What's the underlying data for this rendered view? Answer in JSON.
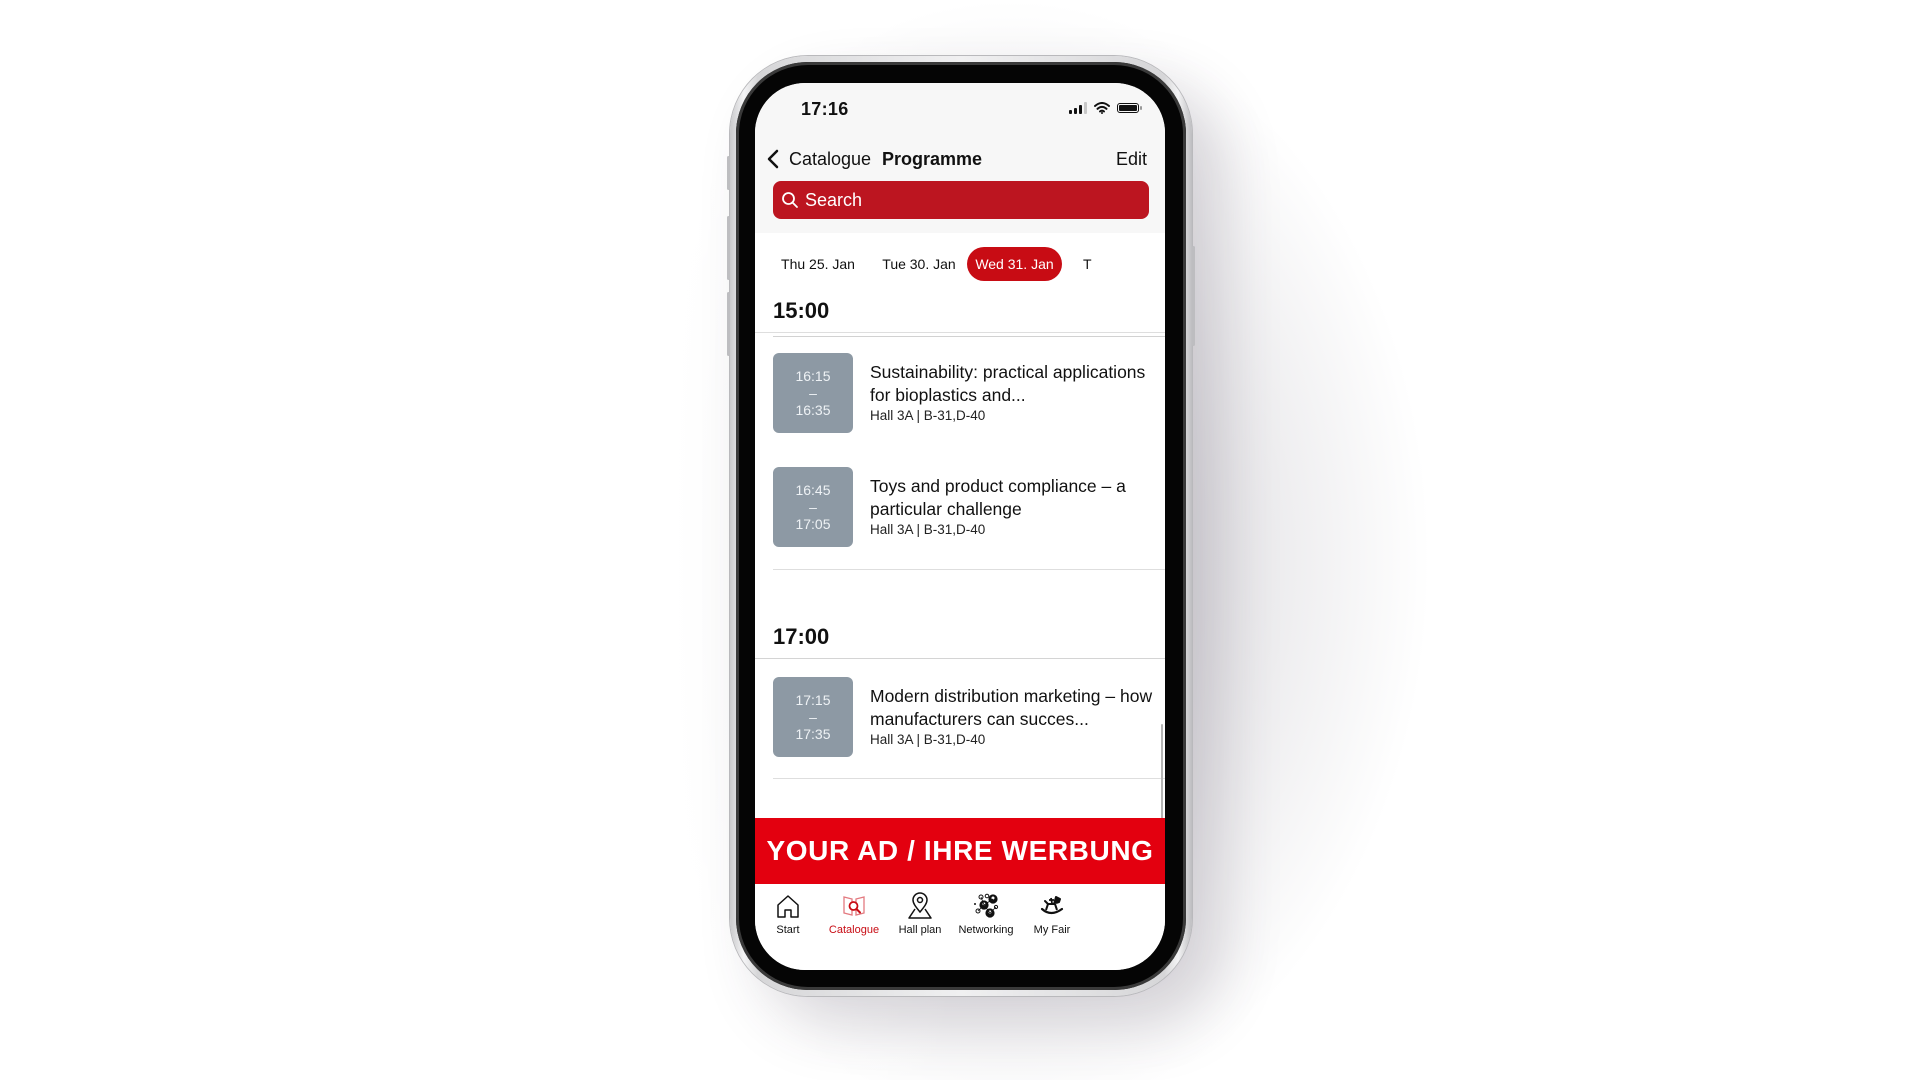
{
  "status_bar": {
    "time": "17:16"
  },
  "nav": {
    "back_label": "Catalogue",
    "title": "Programme",
    "edit_label": "Edit"
  },
  "search": {
    "placeholder": "Search",
    "value": ""
  },
  "date_tabs": [
    {
      "label": "Thu 25. Jan",
      "active": false
    },
    {
      "label": "Tue 30. Jan",
      "active": false
    },
    {
      "label": "Wed 31. Jan",
      "active": true
    },
    {
      "label": "T",
      "active": false
    }
  ],
  "sections": [
    {
      "heading": "15:00",
      "events": [
        {
          "start": "16:15",
          "dash": "–",
          "end": "16:35",
          "title": "Sustainability: practical applications for bioplastics and...",
          "location": "Hall 3A | B-31,D-40"
        },
        {
          "start": "16:45",
          "dash": "–",
          "end": "17:05",
          "title": "Toys and product compliance – a particular challenge",
          "location": "Hall 3A | B-31,D-40"
        }
      ]
    },
    {
      "heading": "17:00",
      "events": [
        {
          "start": "17:15",
          "dash": "–",
          "end": "17:35",
          "title": "Modern distribution marketing – how manufacturers can succes...",
          "location": "Hall 3A | B-31,D-40"
        }
      ]
    }
  ],
  "ad_banner": {
    "text": "YOUR AD / IHRE WERBUNG"
  },
  "tab_bar": [
    {
      "label": "Start",
      "icon": "home-icon",
      "active": false
    },
    {
      "label": "Catalogue",
      "icon": "catalogue-search-icon",
      "active": true
    },
    {
      "label": "Hall plan",
      "icon": "map-pin-icon",
      "active": false
    },
    {
      "label": "Networking",
      "icon": "network-people-icon",
      "active": false
    },
    {
      "label": "My Fair",
      "icon": "rocking-horse-icon",
      "active": false
    }
  ],
  "colors": {
    "accent": "#c80c14",
    "search_bg": "#bc1520",
    "ad_bg": "#e3000f",
    "time_box": "#8d99a4"
  }
}
